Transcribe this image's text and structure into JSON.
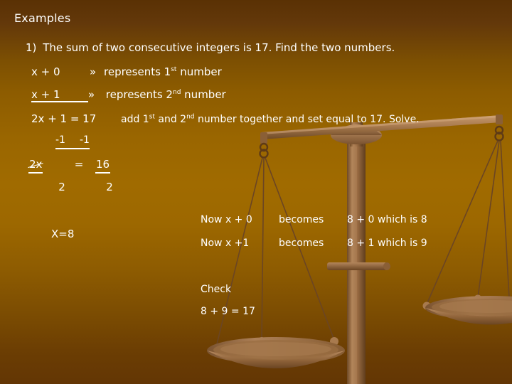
{
  "slide": {
    "title": "Examples",
    "background_top_color": "#5a3104",
    "background_mid_color": "#a06b00",
    "background_bottom_color": "#633604",
    "text_color": "#ffffff"
  },
  "problem": {
    "number": "1)",
    "statement": "The sum of two consecutive integers is 17.  Find the two numbers."
  },
  "setup": [
    {
      "expression": "x + 0",
      "arrow": "»",
      "description_pre": "represents 1",
      "description_sup": "st",
      "description_post": " number",
      "underlined": false
    },
    {
      "expression": "x + 1",
      "arrow": "»",
      "description_pre": " represents 2",
      "description_sup": "nd",
      "description_post": " number",
      "underlined": true
    }
  ],
  "equation": {
    "line": "2x + 1 = 17",
    "note_pre": "add 1",
    "note_sup1": "st",
    "note_mid": " and 2",
    "note_sup2": "nd",
    "note_post": " number together and set equal to 17.  Solve."
  },
  "subtraction_step": {
    "left": "-1",
    "right": "-1"
  },
  "division_step": {
    "numerator_left": "2x",
    "equals": "=",
    "numerator_right": "16",
    "denominator_left": "2",
    "denominator_right": "2"
  },
  "answer": "X=8",
  "substitutions": [
    {
      "expression": "Now x + 0",
      "verb": "becomes",
      "result": "8 + 0  which is 8"
    },
    {
      "expression": "Now x +1",
      "verb": "becomes",
      "result": "8 + 1  which is 9"
    }
  ],
  "check": {
    "label": "Check",
    "equation": "8 + 9 = 17"
  },
  "artwork": {
    "name": "balance-scale",
    "beam_color": "#a87a4e",
    "post_color": "#9d7048",
    "pan_color": "#a57a52",
    "chain_color": "#5e3a16"
  }
}
